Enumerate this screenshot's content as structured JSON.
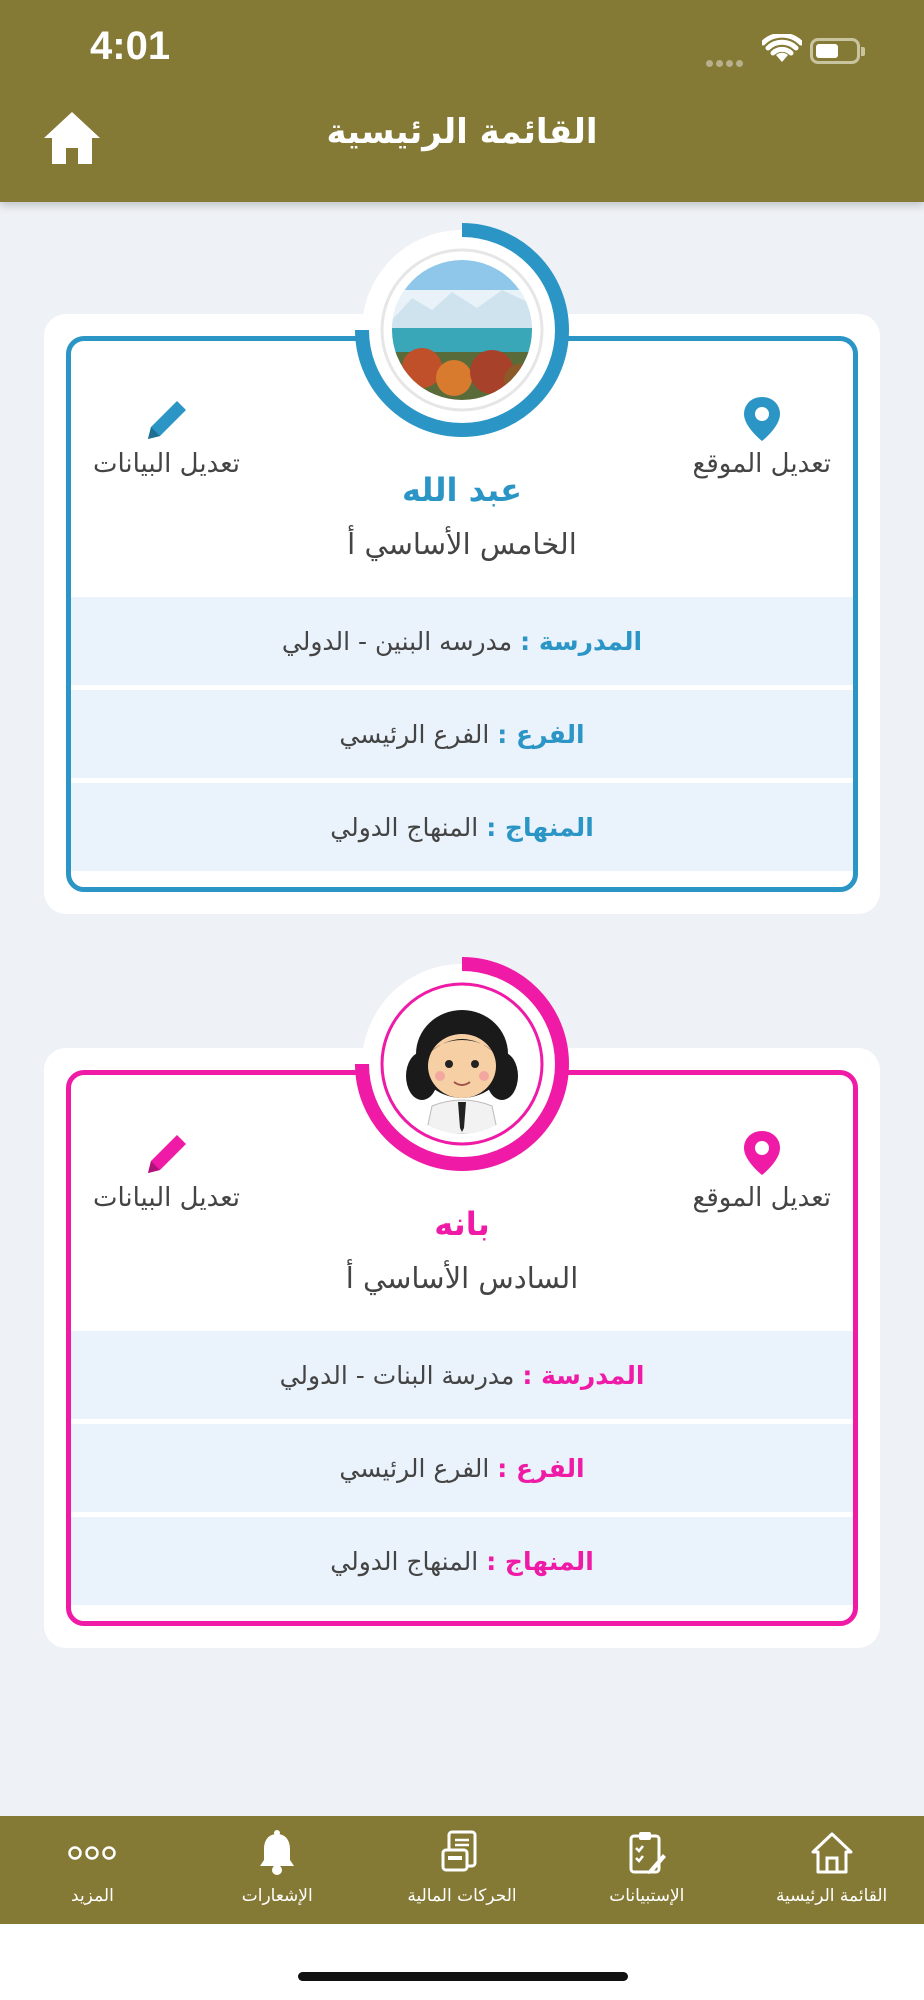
{
  "status": {
    "time": "4:01"
  },
  "header": {
    "title": "القائمة الرئيسية"
  },
  "students": [
    {
      "accent": "#2b96c6",
      "name": "عبد الله",
      "grade": "الخامس الأساسي أ",
      "edit_location": "تعديل الموقع",
      "edit_data": "تعديل البيانات",
      "rows": [
        {
          "label": "المدرسة :",
          "value": "مدرسه البنين - الدولي"
        },
        {
          "label": "الفرع :",
          "value": "الفرع الرئيسي"
        },
        {
          "label": "المنهاج :",
          "value": "المنهاج الدولي"
        }
      ],
      "avatar": "landscape-photo"
    },
    {
      "accent": "#ef1ba6",
      "name": "بانه",
      "grade": "السادس الأساسي أ",
      "edit_location": "تعديل الموقع",
      "edit_data": "تعديل البيانات",
      "rows": [
        {
          "label": "المدرسة :",
          "value": "مدرسة البنات - الدولي"
        },
        {
          "label": "الفرع :",
          "value": "الفرع الرئيسي"
        },
        {
          "label": "المنهاج :",
          "value": "المنهاج الدولي"
        }
      ],
      "avatar": "girl-cartoon"
    }
  ],
  "bottom_nav": [
    {
      "label": "القائمة الرئيسية",
      "icon": "home-icon"
    },
    {
      "label": "الإستبيانات",
      "icon": "survey-icon"
    },
    {
      "label": "الحركات المالية",
      "icon": "finance-icon"
    },
    {
      "label": "الإشعارات",
      "icon": "bell-icon"
    },
    {
      "label": "المزيد",
      "icon": "more-icon"
    }
  ],
  "colors": {
    "header_bg": "#857a35",
    "page_bg": "#eef1f6"
  }
}
